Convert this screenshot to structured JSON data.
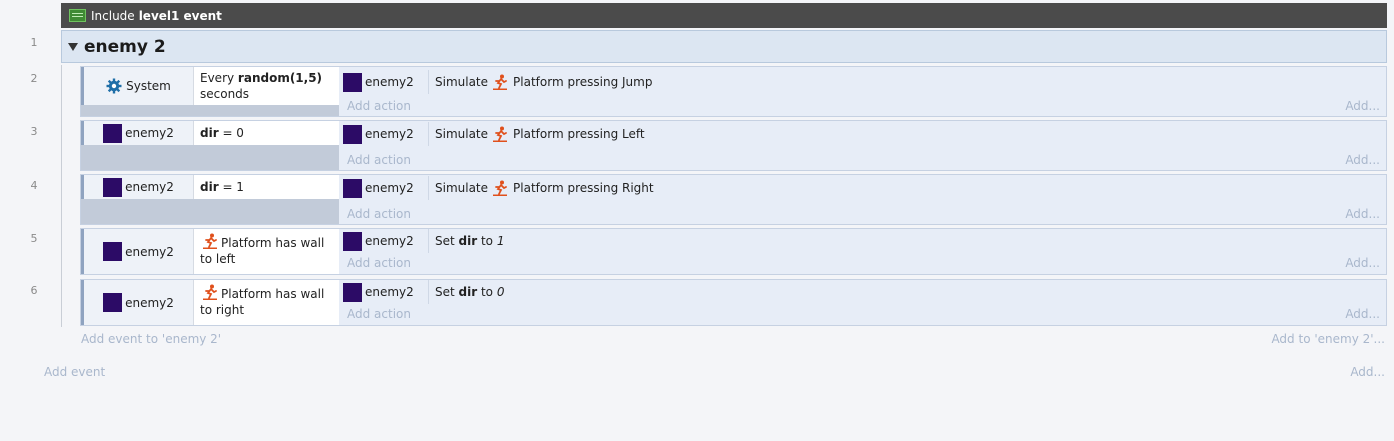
{
  "include": {
    "label": "Include",
    "name": "level1 event"
  },
  "line_numbers": [
    "1",
    "2",
    "3",
    "4",
    "5",
    "6"
  ],
  "group": {
    "name": "enemy 2"
  },
  "events": [
    {
      "cond_object": "System",
      "cond_pre": "Every ",
      "cond_bold": "random(1,5)",
      "cond_post": "seconds",
      "act_object": "enemy2",
      "act_pre": "Simulate ",
      "act_post": "Platform pressing Jump"
    },
    {
      "cond_object": "enemy2",
      "cond_bold": "dir",
      "cond_post": " = 0",
      "act_object": "enemy2",
      "act_pre": "Simulate ",
      "act_post": "Platform pressing Left"
    },
    {
      "cond_object": "enemy2",
      "cond_bold": "dir",
      "cond_post": " = 1",
      "act_object": "enemy2",
      "act_pre": "Simulate ",
      "act_post": "Platform pressing Right"
    },
    {
      "cond_object": "enemy2",
      "cond_text": "Platform has wall to left",
      "act_object": "enemy2",
      "act_pre": "Set ",
      "act_bold": "dir",
      "act_mid": " to ",
      "act_italic": "1"
    },
    {
      "cond_object": "enemy2",
      "cond_text": "Platform has wall to right",
      "act_object": "enemy2",
      "act_pre": "Set ",
      "act_bold": "dir",
      "act_mid": " to ",
      "act_italic": "0"
    }
  ],
  "add_action_label": "Add action",
  "add_dots": "Add...",
  "add_event_to_group": "Add event to 'enemy 2'",
  "add_to_group": "Add to 'enemy 2'...",
  "add_event": "Add event",
  "colors": {
    "object_swatch": "#2c0b66",
    "behavior_icon": "#e0501c",
    "gear": "#1f6fa8"
  }
}
